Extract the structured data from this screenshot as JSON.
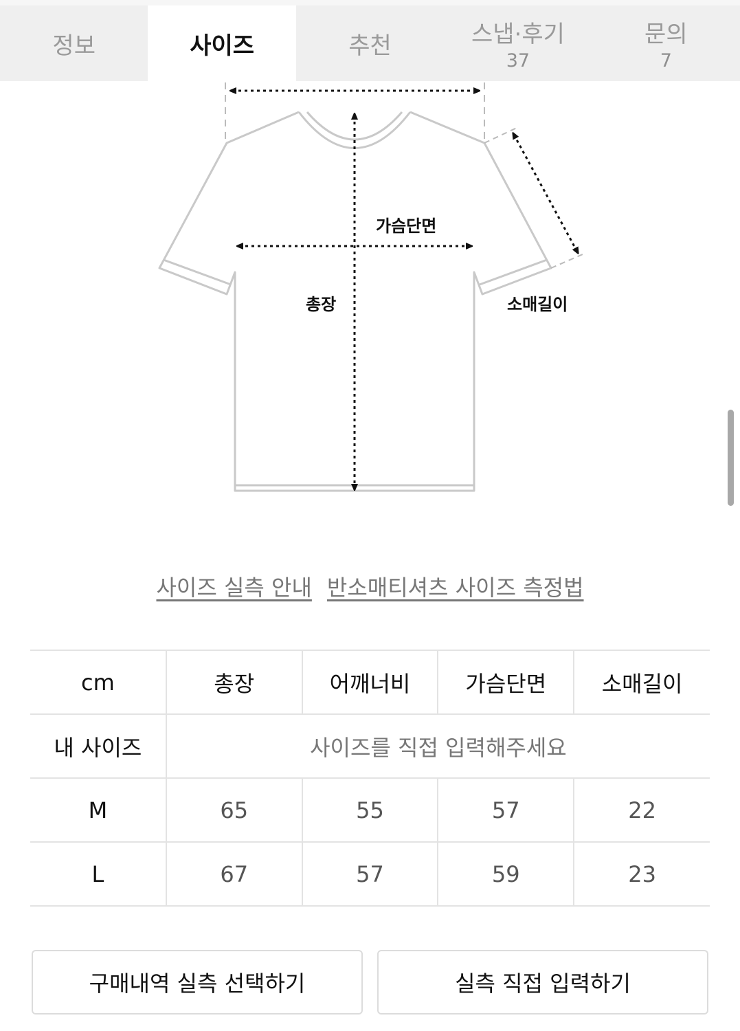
{
  "tabs": [
    {
      "label": "정보",
      "count": ""
    },
    {
      "label": "사이즈",
      "count": ""
    },
    {
      "label": "추천",
      "count": ""
    },
    {
      "label": "스냅·후기",
      "count": "37"
    },
    {
      "label": "문의",
      "count": "7"
    }
  ],
  "active_tab": "사이즈",
  "diagram": {
    "chest_label": "가슴단면",
    "length_label": "총장",
    "sleeve_label": "소매길이"
  },
  "links": {
    "size_guide": "사이즈 실측 안내",
    "measure_method": "반소매티셔츠 사이즈 측정법"
  },
  "size_table": {
    "columns": [
      "cm",
      "총장",
      "어깨너비",
      "가슴단면",
      "소매길이"
    ],
    "my_size_label": "내 사이즈",
    "my_size_placeholder": "사이즈를 직접 입력해주세요",
    "rows": [
      {
        "size": "M",
        "values": [
          "65",
          "55",
          "57",
          "22"
        ]
      },
      {
        "size": "L",
        "values": [
          "67",
          "57",
          "59",
          "23"
        ]
      }
    ]
  },
  "buttons": {
    "purchase_history": "구매내역 실측 선택하기",
    "direct_input": "실측 직접 입력하기"
  }
}
